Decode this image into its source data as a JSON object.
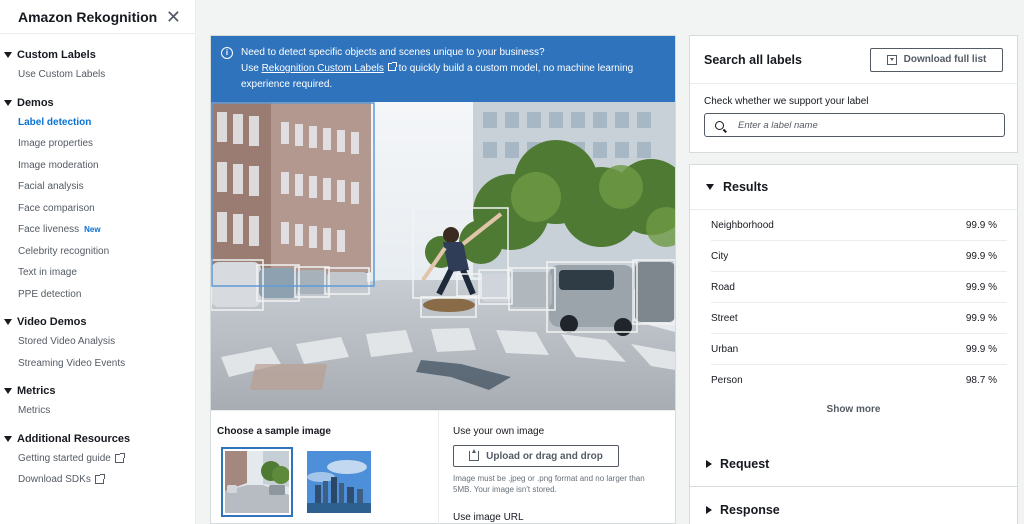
{
  "sidebar": {
    "title": "Amazon Rekognition",
    "sections": [
      {
        "title": "Custom Labels",
        "items": [
          {
            "label": "Use Custom Labels"
          }
        ]
      },
      {
        "title": "Demos",
        "items": [
          {
            "label": "Label detection",
            "active": true
          },
          {
            "label": "Image properties"
          },
          {
            "label": "Image moderation"
          },
          {
            "label": "Facial analysis"
          },
          {
            "label": "Face comparison"
          },
          {
            "label": "Face liveness",
            "badge": "New"
          },
          {
            "label": "Celebrity recognition"
          },
          {
            "label": "Text in image"
          },
          {
            "label": "PPE detection"
          }
        ]
      },
      {
        "title": "Video Demos",
        "items": [
          {
            "label": "Stored Video Analysis"
          },
          {
            "label": "Streaming Video Events"
          }
        ]
      },
      {
        "title": "Metrics",
        "items": [
          {
            "label": "Metrics"
          }
        ]
      },
      {
        "title": "Additional Resources",
        "items": [
          {
            "label": "Getting started guide",
            "external": true
          },
          {
            "label": "Download SDKs",
            "external": true
          }
        ]
      }
    ]
  },
  "banner": {
    "line1": "Need to detect specific objects and scenes unique to your business?",
    "line2_prefix": "Use ",
    "link": "Rekognition Custom Labels",
    "line2_suffix": " to quickly build a custom model, no machine learning",
    "line3": "experience required."
  },
  "sample": {
    "title": "Choose a sample image"
  },
  "own_image": {
    "title": "Use your own image",
    "upload_label": "Upload or drag and drop",
    "note": "Image must be .jpeg or .png format and no larger than 5MB. Your image isn't stored.",
    "url_label": "Use image URL"
  },
  "search": {
    "title": "Search all labels",
    "download_label": "Download full list",
    "check_label": "Check whether we support your label",
    "placeholder": "Enter a label name"
  },
  "results": {
    "title": "Results",
    "rows": [
      {
        "label": "Neighborhood",
        "value": "99.9 %"
      },
      {
        "label": "City",
        "value": "99.9 %"
      },
      {
        "label": "Road",
        "value": "99.9 %"
      },
      {
        "label": "Street",
        "value": "99.9 %"
      },
      {
        "label": "Urban",
        "value": "99.9 %"
      },
      {
        "label": "Person",
        "value": "98.7 %"
      }
    ],
    "show_more": "Show more"
  },
  "request": {
    "title": "Request"
  },
  "response": {
    "title": "Response"
  },
  "colors": {
    "accent": "#0972d3",
    "banner": "#2f73bd",
    "selection": "#2f73bd"
  }
}
